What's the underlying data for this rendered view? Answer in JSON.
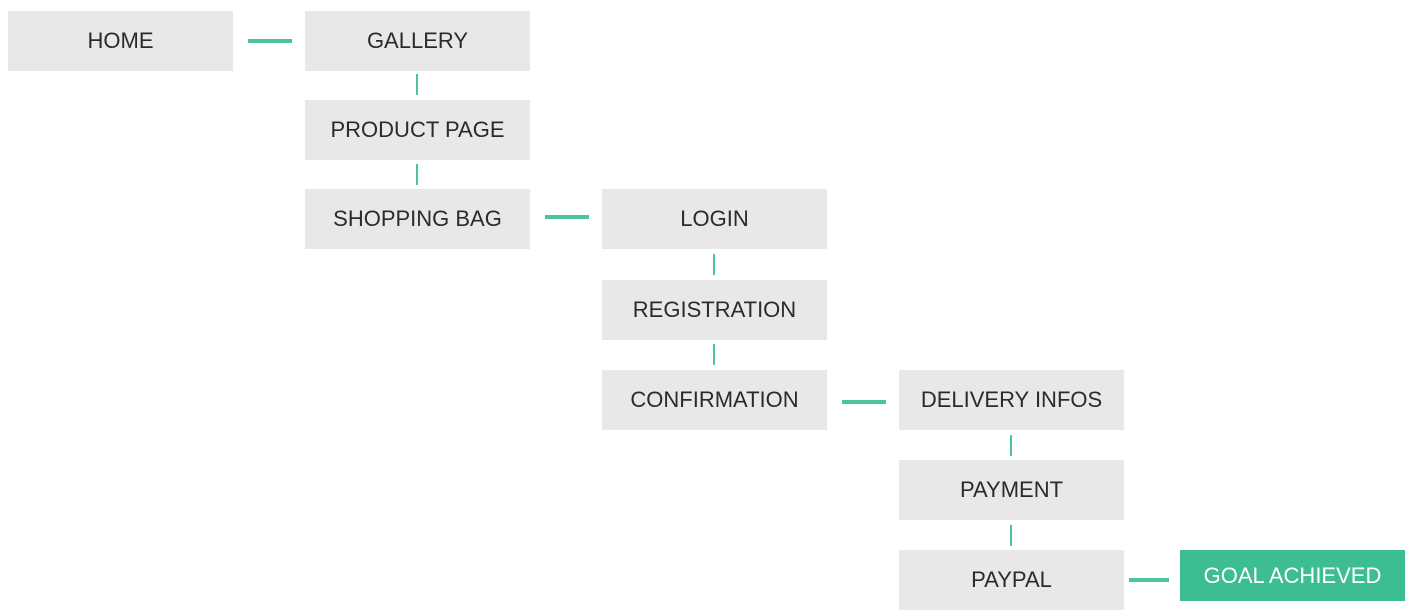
{
  "flow": {
    "nodes": {
      "home": "HOME",
      "gallery": "GALLERY",
      "product_page": "PRODUCT PAGE",
      "shopping_bag": "SHOPPING BAG",
      "login": "LOGIN",
      "registration": "REGISTRATION",
      "confirmation": "CONFIRMATION",
      "delivery_infos": "DELIVERY INFOS",
      "payment": "PAYMENT",
      "paypal": "PAYPAL",
      "goal_achieved": "GOAL ACHIEVED"
    }
  },
  "colors": {
    "node_bg": "#e7e8e7",
    "node_text": "#2b2b2b",
    "connector": "#4cc49a",
    "goal_bg": "#3cbe90",
    "goal_text": "#ffffff"
  }
}
